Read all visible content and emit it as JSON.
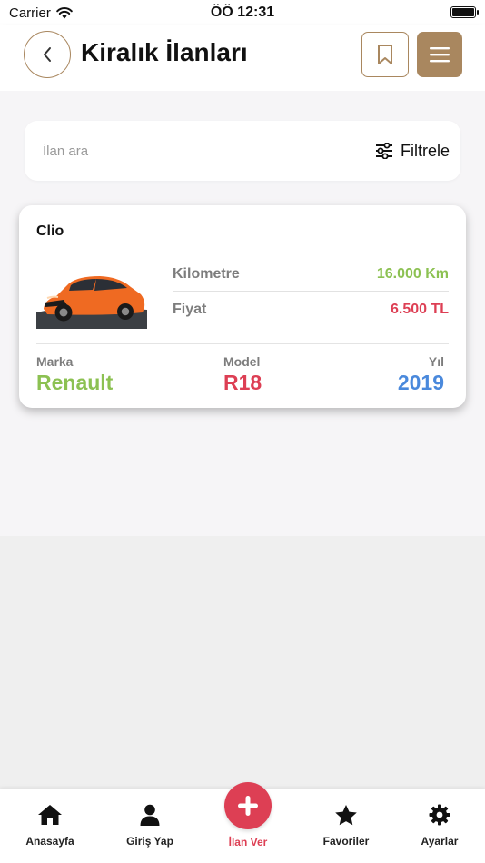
{
  "status_bar": {
    "carrier": "Carrier",
    "time": "ÖÖ 12:31"
  },
  "header": {
    "title": "Kiralık İlanları",
    "accent_color": "#a9875f"
  },
  "search": {
    "placeholder": "İlan ara",
    "filter_label": "Filtrele"
  },
  "listing": {
    "name": "Clio",
    "kilometre_label": "Kilometre",
    "kilometre_value": "16.000 Km",
    "price_label": "Fiyat",
    "price_value": "6.500 TL",
    "brand_label": "Marka",
    "brand_value": "Renault",
    "model_label": "Model",
    "model_value": "R18",
    "year_label": "Yıl",
    "year_value": "2019",
    "colors": {
      "green": "#8cc152",
      "red": "#dd3f54",
      "blue": "#4a89dc"
    }
  },
  "tabbar": {
    "items": [
      {
        "label": "Anasayfa",
        "icon": "home-icon"
      },
      {
        "label": "Giriş Yap",
        "icon": "user-icon"
      },
      {
        "label": "İlan Ver",
        "icon": "plus-icon"
      },
      {
        "label": "Favoriler",
        "icon": "star-icon"
      },
      {
        "label": "Ayarlar",
        "icon": "gear-icon"
      }
    ]
  }
}
